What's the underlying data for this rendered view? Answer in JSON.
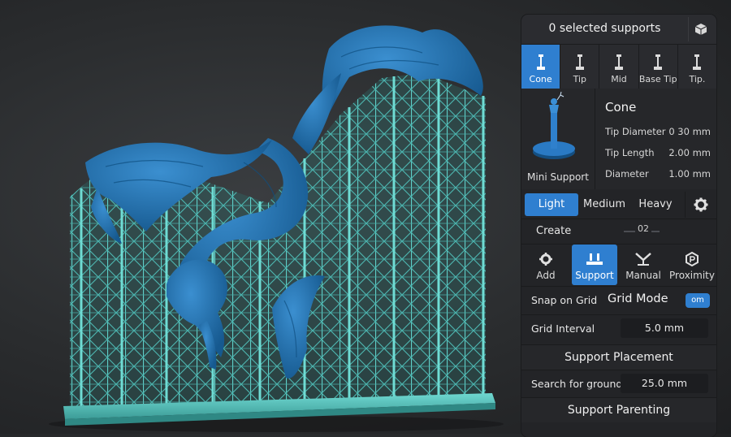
{
  "header": {
    "title": "0 selected supports",
    "icon": "cube-icon"
  },
  "support_types": [
    {
      "label": "Cone",
      "active": true
    },
    {
      "label": "Tip",
      "active": false
    },
    {
      "label": "Mid",
      "active": false
    },
    {
      "label": "Base Tip",
      "active": false
    },
    {
      "label": "Tip.",
      "active": false
    }
  ],
  "detail": {
    "preview_caption": "Mini Support",
    "name": "Cone",
    "specs": [
      {
        "label": "Tip Diameter",
        "value": "0 30 mm"
      },
      {
        "label": "Tip Length",
        "value": "2.00 mm"
      },
      {
        "label": "Diameter",
        "value": "1.00 mm"
      }
    ]
  },
  "weights": {
    "options": [
      "Light",
      "Medium",
      "Heavy"
    ],
    "selected": "Light",
    "settings_icon": "gear-icon"
  },
  "create": {
    "label": "Create",
    "value": "02"
  },
  "modes": [
    {
      "label": "Add",
      "icon": "gear-add-icon",
      "active": false
    },
    {
      "label": "Support",
      "icon": "support-icon",
      "active": true
    },
    {
      "label": "Manual",
      "icon": "manual-icon",
      "active": false
    },
    {
      "label": "Proximity",
      "icon": "proximity-icon",
      "active": false
    }
  ],
  "snap": {
    "label": "Snap on Grid",
    "mode_label": "Grid Mode",
    "toggle_text": "om"
  },
  "grid_interval": {
    "label": "Grid Interval",
    "value": "5.0 mm"
  },
  "placement": {
    "title": "Support Placement"
  },
  "search": {
    "label": "Search for ground",
    "value": "25.0 mm"
  },
  "parenting": {
    "title": "Support Parenting"
  },
  "colors": {
    "accent": "#2f7fd0",
    "model": "#1e72b8",
    "supports": "#56c7c2",
    "panel": "#232427"
  }
}
